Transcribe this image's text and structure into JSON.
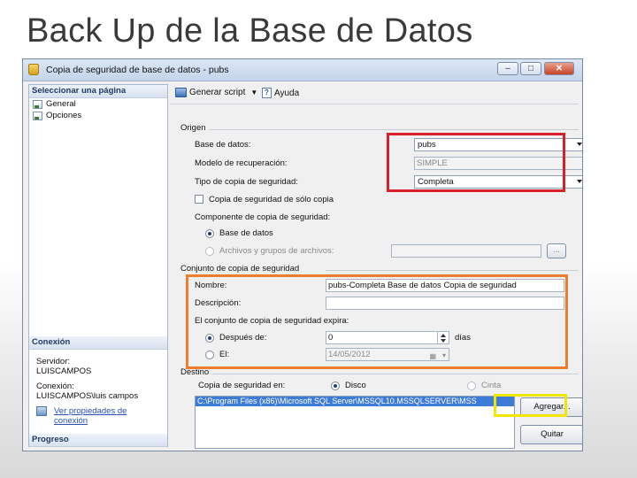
{
  "slide": {
    "title": "Back Up de la Base de Datos"
  },
  "window": {
    "title": "Copia de seguridad de base de datos - pubs",
    "controls": {
      "minimize": "–",
      "maximize": "□",
      "close": "✕"
    }
  },
  "left_panel": {
    "select_page": {
      "header": "Seleccionar una página",
      "items": [
        {
          "label": "General"
        },
        {
          "label": "Opciones"
        }
      ]
    },
    "connection": {
      "header": "Conexión",
      "server_label": "Servidor:",
      "server_value": "LUISCAMPOS",
      "conn_label": "Conexión:",
      "conn_value": "LUISCAMPOS\\luis campos",
      "link_line1": "Ver propiedades de",
      "link_line2": "conexión"
    },
    "progress": {
      "header": "Progreso"
    }
  },
  "toolbar": {
    "script_label": "Generar script",
    "help_label": "Ayuda"
  },
  "origen": {
    "header": "Origen",
    "database_label": "Base de datos:",
    "database_value": "pubs",
    "recovery_label": "Modelo de recuperación:",
    "recovery_value": "SIMPLE",
    "backup_type_label": "Tipo de copia de seguridad:",
    "backup_type_value": "Completa",
    "copy_only_label": "Copia de seguridad de sólo copia",
    "component_label": "Componente de copia de seguridad:",
    "component_db": "Base de datos",
    "component_files": "Archivos y grupos de archivos:",
    "browse_label": "..."
  },
  "backup_set": {
    "header": "Conjunto de copia de seguridad",
    "name_label": "Nombre:",
    "name_value": "pubs-Completa Base de datos Copia de seguridad",
    "desc_label": "Descripción:",
    "desc_value": "",
    "expires_label": "El conjunto de copia de seguridad expira:",
    "after_label": "Después de:",
    "after_value": "0",
    "days_label": "días",
    "on_label": "El:",
    "on_value": "14/05/2012"
  },
  "destino": {
    "header": "Destino",
    "backup_to_label": "Copia de seguridad en:",
    "disk_label": "Disco",
    "tape_label": "Cinta",
    "path": "C:\\Program Files (x86)\\Microsoft SQL Server\\MSSQL10.MSSQLSERVER\\MSS",
    "add_button": "Agregar...",
    "remove_button": "Quitar"
  },
  "colors": {
    "highlight_red": "#d9202a",
    "highlight_orange": "#ee7d2d",
    "highlight_yellow": "#f2e600"
  }
}
